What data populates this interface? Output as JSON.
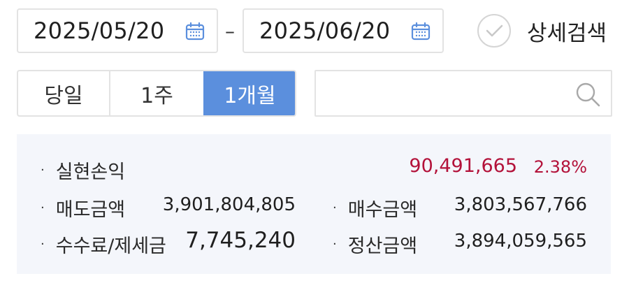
{
  "date_range": {
    "start": "2025/05/20",
    "end": "2025/06/20",
    "separator": "–"
  },
  "detail_search": {
    "label": "상세검색",
    "checked": false
  },
  "period_tabs": [
    {
      "label": "당일",
      "selected": false
    },
    {
      "label": "1주",
      "selected": false
    },
    {
      "label": "1개월",
      "selected": true
    }
  ],
  "search": {
    "value": "",
    "placeholder": ""
  },
  "summary": {
    "bullet": "·",
    "realized_pl": {
      "label": "실현손익",
      "value": "90,491,665",
      "rate": "2.38%"
    },
    "sell_amount": {
      "label": "매도금액",
      "value": "3,901,804,805"
    },
    "buy_amount": {
      "label": "매수금액",
      "value": "3,803,567,766"
    },
    "fee_tax": {
      "label": "수수료/제세금",
      "value": "7,745,240"
    },
    "settlement_amount": {
      "label": "정산금액",
      "value": "3,894,059,565"
    }
  },
  "colors": {
    "accent": "#5b8fdd",
    "profit": "#b3123a",
    "summary_bg": "#f4f6fb",
    "border": "#e3e3e3"
  },
  "icons": [
    "calendar-icon",
    "check-circle-icon",
    "search-icon"
  ]
}
